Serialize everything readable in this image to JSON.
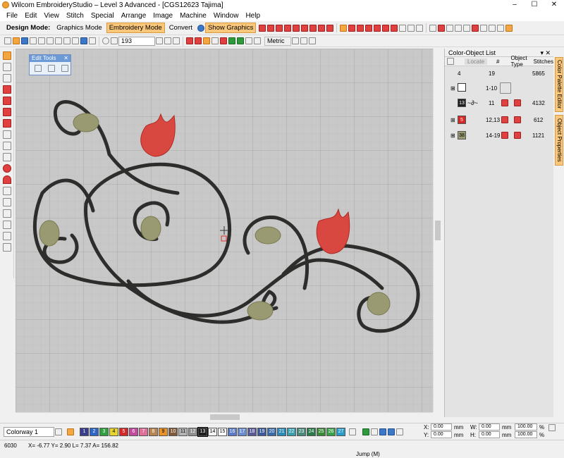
{
  "window": {
    "title": "Wilcom EmbroideryStudio – Level 3 Advanced - [CGS12623        Tajima]",
    "minimize": "–",
    "maximize": "☐",
    "close": "✕"
  },
  "menu": [
    "File",
    "Edit",
    "View",
    "Stitch",
    "Special",
    "Arrange",
    "Image",
    "Machine",
    "Window",
    "Help"
  ],
  "toolbar": {
    "design_mode_label": "Design Mode:",
    "graphics_mode": "Graphics Mode",
    "embroidery_mode": "Embroidery Mode",
    "convert": "Convert",
    "show_graphics": "Show Graphics",
    "zoom_value": "193",
    "units": "Metric"
  },
  "edit_tools": {
    "title": "Edit Tools",
    "close": "✕"
  },
  "panel": {
    "title": "Color-Object List",
    "pin": "▾ ✕",
    "headers": {
      "locate": "Locate",
      "num": "#",
      "object_type": "Object Type",
      "stitches": "Stitches"
    },
    "summary": {
      "count": "4",
      "num": "19",
      "stitches": "5865"
    },
    "rows": [
      {
        "color_label": "",
        "color": "#ffffff",
        "num": "1-10",
        "stitches": ""
      },
      {
        "color_label": "13",
        "color": "#1e1e1e",
        "num": "11",
        "stitches": "4132"
      },
      {
        "color_label": "5",
        "color": "#d42828",
        "num": "12,13",
        "stitches": "612"
      },
      {
        "color_label": "38",
        "color": "#9a9a72",
        "num": "14-19",
        "stitches": "1121"
      }
    ]
  },
  "side_tabs": {
    "palette": "Color Palette Editor",
    "props": "Object Properties"
  },
  "colorway": {
    "selected": "Colorway 1",
    "swatches": [
      {
        "n": "1",
        "c": "#3a3c8c"
      },
      {
        "n": "2",
        "c": "#2e66c8"
      },
      {
        "n": "3",
        "c": "#2fa03e"
      },
      {
        "n": "4",
        "c": "#e6d430"
      },
      {
        "n": "5",
        "c": "#d42828"
      },
      {
        "n": "6",
        "c": "#c44aa0"
      },
      {
        "n": "7",
        "c": "#e0709a"
      },
      {
        "n": "8",
        "c": "#b88452"
      },
      {
        "n": "9",
        "c": "#e8922a"
      },
      {
        "n": "10",
        "c": "#7c5a3a"
      },
      {
        "n": "11",
        "c": "#b4b4b4"
      },
      {
        "n": "12",
        "c": "#909090"
      },
      {
        "n": "13",
        "c": "#1e1e1e"
      },
      {
        "n": "14",
        "c": "#f4f4f4"
      },
      {
        "n": "15",
        "c": "#ffffff"
      },
      {
        "n": "16",
        "c": "#5a7cc8"
      },
      {
        "n": "17",
        "c": "#6a8cd0"
      },
      {
        "n": "18",
        "c": "#5a5a9a"
      },
      {
        "n": "19",
        "c": "#3a5a9a"
      },
      {
        "n": "20",
        "c": "#3a6aa8"
      },
      {
        "n": "21",
        "c": "#2a8ab8"
      },
      {
        "n": "22",
        "c": "#3aa0b0"
      },
      {
        "n": "23",
        "c": "#4a8a7a"
      },
      {
        "n": "24",
        "c": "#2a7a4a"
      },
      {
        "n": "25",
        "c": "#3a8a3a"
      },
      {
        "n": "26",
        "c": "#3aa04a"
      },
      {
        "n": "27",
        "c": "#2a9ac8"
      }
    ]
  },
  "coords": {
    "x_label": "X:",
    "x": "0.00",
    "y_label": "Y:",
    "y": "0.00",
    "w_label": "W:",
    "w": "0.00",
    "h_label": "H:",
    "h": "0.00",
    "unit": "mm",
    "pct_w": "100.00",
    "pct_h": "100.00",
    "pct": "%"
  },
  "status": {
    "stitches": "6030",
    "coords": "X=  -6.77 Y=   2.90 L=   7.37 A= 156.82",
    "mode": "Jump (M)"
  }
}
